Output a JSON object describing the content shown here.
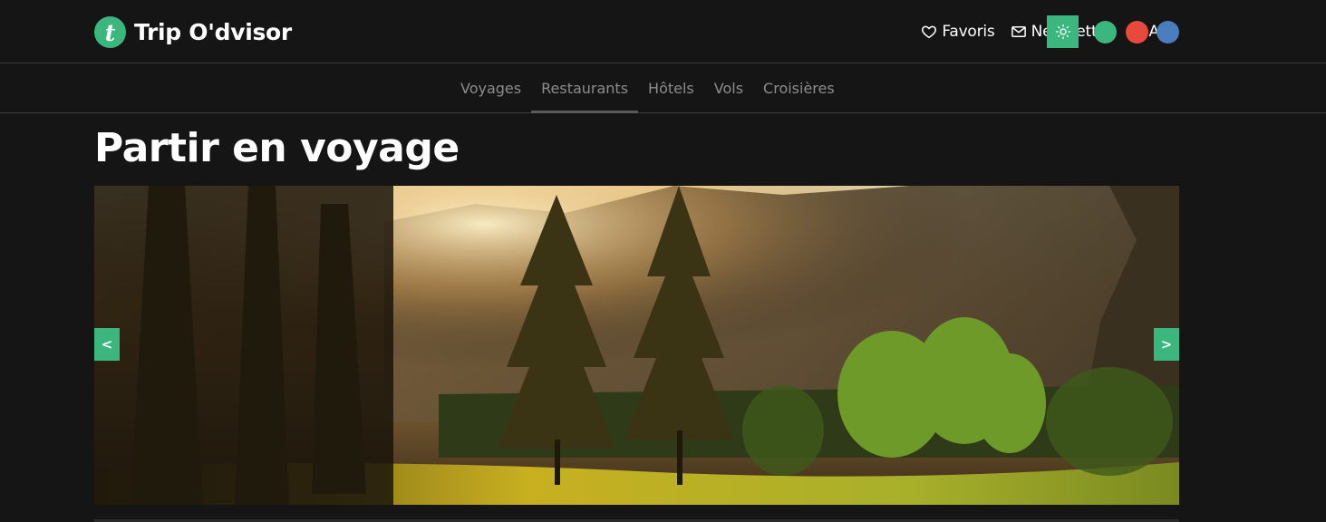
{
  "brand": {
    "logo_letter": "t",
    "name": "Trip O'dvisor"
  },
  "topnav": {
    "favorites": "Favoris",
    "newsletter": "Newsletter",
    "reviews": "Avis"
  },
  "theme": {
    "icon": "sun-icon",
    "accent": "#3bb77e"
  },
  "color_swatches": [
    "#3bb77e",
    "#e8493b",
    "#4a7dbd"
  ],
  "subnav": {
    "items": [
      {
        "label": "Voyages"
      },
      {
        "label": "Restaurants",
        "active": true
      },
      {
        "label": "Hôtels"
      },
      {
        "label": "Vols"
      },
      {
        "label": "Croisières"
      }
    ]
  },
  "page_title": "Partir en voyage",
  "carousel": {
    "prev_label": "<",
    "next_label": ">"
  }
}
